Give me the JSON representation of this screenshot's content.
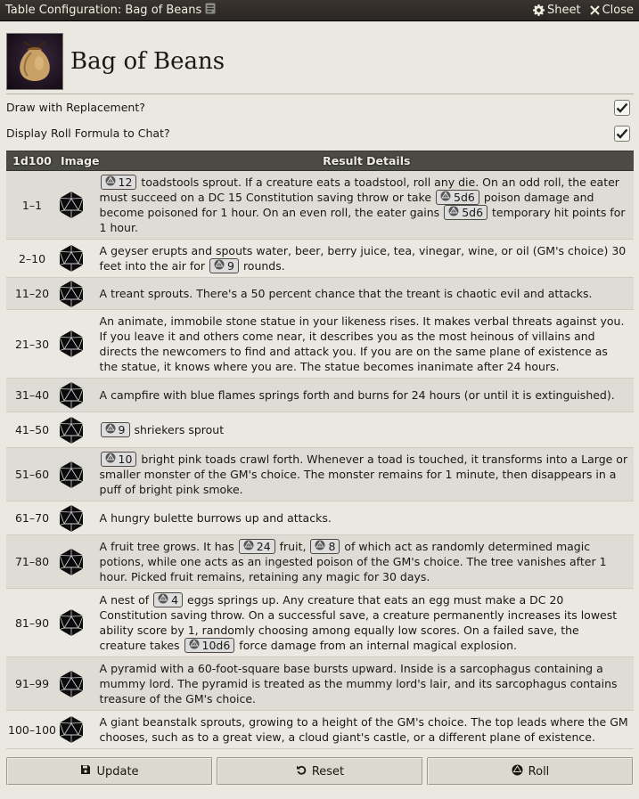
{
  "window": {
    "title": "Table Configuration: Bag of Beans",
    "sheet_label": "Sheet",
    "close_label": "Close"
  },
  "header": {
    "name": "Bag of Beans"
  },
  "options": [
    {
      "label": "Draw with Replacement?",
      "checked": true
    },
    {
      "label": "Display Roll Formula to Chat?",
      "checked": true
    }
  ],
  "table": {
    "col_range": "1d100",
    "col_image": "Image",
    "col_details": "Result Details",
    "rows": [
      {
        "range": "1–1",
        "parts": [
          {
            "roll": "12"
          },
          {
            "t": " toadstools sprout. If a creature eats a toadstool, roll any die. On an odd roll, the eater must succeed on a DC 15 Constitution saving throw or take "
          },
          {
            "roll": "5d6"
          },
          {
            "t": " poison damage and become poisoned for 1 hour. On an even roll, the eater gains "
          },
          {
            "roll": "5d6"
          },
          {
            "t": " temporary hit points for 1 hour."
          }
        ]
      },
      {
        "range": "2–10",
        "parts": [
          {
            "t": "A geyser erupts and spouts water, beer, berry juice, tea, vinegar, wine, or oil (GM's choice) 30 feet into the air for "
          },
          {
            "roll": "9"
          },
          {
            "t": " rounds."
          }
        ]
      },
      {
        "range": "11–20",
        "parts": [
          {
            "t": "A treant sprouts. There's a 50 percent chance that the treant is chaotic evil and attacks."
          }
        ]
      },
      {
        "range": "21–30",
        "parts": [
          {
            "t": "An animate, immobile stone statue in your likeness rises. It makes verbal threats against you. If you leave it and others come near, it describes you as the most heinous of villains and directs the newcomers to find and attack you. If you are on the same plane of existence as the statue, it knows where you are. The statue becomes inanimate after 24 hours."
          }
        ]
      },
      {
        "range": "31–40",
        "parts": [
          {
            "t": "A campfire with blue flames springs forth and burns for 24 hours (or until it is extinguished)."
          }
        ]
      },
      {
        "range": "41–50",
        "parts": [
          {
            "roll": "9"
          },
          {
            "t": " shriekers sprout"
          }
        ]
      },
      {
        "range": "51–60",
        "parts": [
          {
            "roll": "10"
          },
          {
            "t": " bright pink toads crawl forth. Whenever a toad is touched, it transforms into a Large or smaller monster of the GM's choice. The monster remains for 1 minute, then disappears in a puff of bright pink smoke."
          }
        ]
      },
      {
        "range": "61–70",
        "parts": [
          {
            "t": "A hungry bulette burrows up and attacks."
          }
        ]
      },
      {
        "range": "71–80",
        "parts": [
          {
            "t": "A fruit tree grows. It has "
          },
          {
            "roll": "24"
          },
          {
            "t": " fruit, "
          },
          {
            "roll": "8"
          },
          {
            "t": " of which act as randomly determined magic potions, while one acts as an ingested poison of the GM's choice. The tree vanishes after 1 hour. Picked fruit remains, retaining any magic for 30 days."
          }
        ]
      },
      {
        "range": "81–90",
        "parts": [
          {
            "t": "A nest of "
          },
          {
            "roll": "4"
          },
          {
            "t": " eggs springs up. Any creature that eats an egg must make a DC 20 Constitution saving throw. On a successful save, a creature permanently increases its lowest ability score by 1, randomly choosing among equally low scores. On a failed save, the creature takes "
          },
          {
            "roll": "10d6"
          },
          {
            "t": " force damage from an internal magical explosion."
          }
        ]
      },
      {
        "range": "91–99",
        "parts": [
          {
            "t": "A pyramid with a 60-foot-square base bursts upward. Inside is a sarcophagus containing a mummy lord. The pyramid is treated as the mummy lord's lair, and its sarcophagus contains treasure of the GM's choice."
          }
        ]
      },
      {
        "range": "100–100",
        "parts": [
          {
            "t": "A giant beanstalk sprouts, growing to a height of the GM's choice. The top leads where the GM chooses, such as to a great view, a cloud giant's castle, or a different plane of existence."
          }
        ]
      }
    ]
  },
  "footer": {
    "update": "Update",
    "reset": "Reset",
    "roll": "Roll"
  },
  "icons": {
    "row_image": "d20-icon",
    "inline_roll": "dice-icon"
  },
  "colors": {
    "titlebar": "#2a2623",
    "header_row": "#4b4a44",
    "background": "#ebe8e2"
  }
}
